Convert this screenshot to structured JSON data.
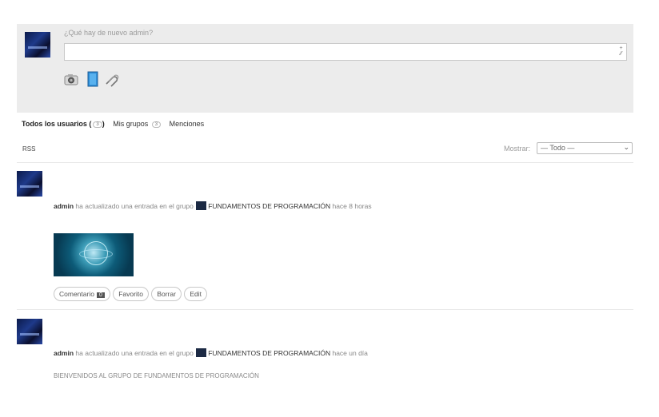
{
  "post_box": {
    "prompt": "¿Qué hay de nuevo admin?",
    "attach_icons": [
      "camera-icon",
      "document-icon",
      "link-icon"
    ]
  },
  "tabs": [
    {
      "label": "Todos los usuarios",
      "count": "3"
    },
    {
      "label": "Mis grupos",
      "count": "3"
    },
    {
      "label": "Menciones"
    }
  ],
  "filter": {
    "rss": "RSS",
    "show_label": "Mostrar:",
    "show_value": "— Todo —"
  },
  "activities": [
    {
      "user": "admin",
      "action": "ha actualizado una entrada en el grupo",
      "group": "FUNDAMENTOS DE PROGRAMACIÓN",
      "time": "hace 8 horas",
      "buttons": {
        "comment": "Comentario",
        "comment_count": "0",
        "favorite": "Favorito",
        "delete": "Borrar",
        "edit": "Edit"
      }
    },
    {
      "user": "admin",
      "action": "ha actualizado una entrada en el grupo",
      "group": "FUNDAMENTOS DE PROGRAMACIÓN",
      "time": "hace un día",
      "body": "BIENVENIDOS AL GRUPO DE FUNDAMENTOS DE PROGRAMACIÓN"
    }
  ]
}
